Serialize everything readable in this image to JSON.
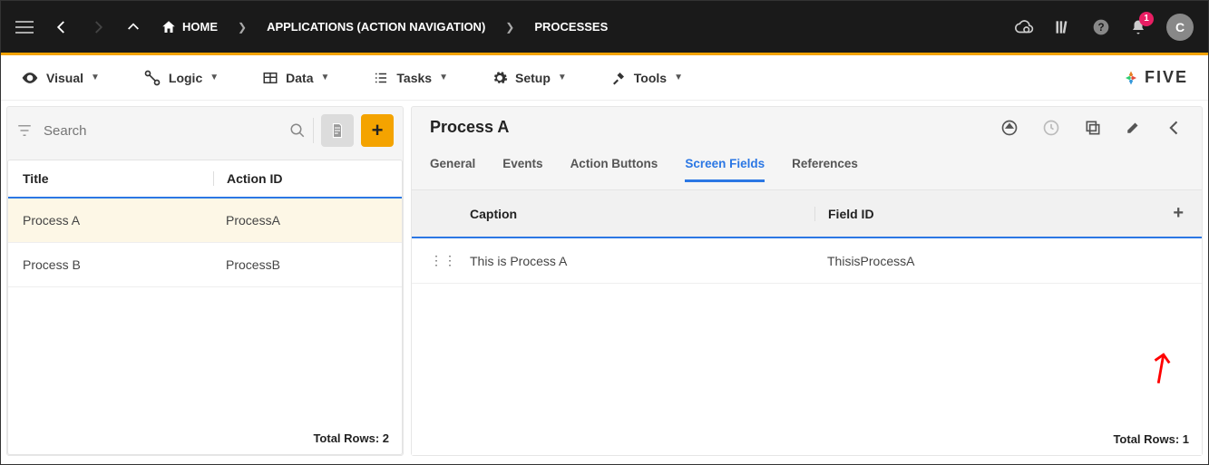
{
  "topbar": {
    "home_label": "HOME",
    "crumb1": "APPLICATIONS (ACTION NAVIGATION)",
    "crumb2": "PROCESSES",
    "notification_count": "1",
    "avatar_letter": "C"
  },
  "menubar": {
    "visual": "Visual",
    "logic": "Logic",
    "data": "Data",
    "tasks": "Tasks",
    "setup": "Setup",
    "tools": "Tools",
    "logo_text": "FIVE"
  },
  "left": {
    "search_placeholder": "Search",
    "col_title": "Title",
    "col_action": "Action ID",
    "rows": [
      {
        "title": "Process A",
        "action_id": "ProcessA",
        "selected": true
      },
      {
        "title": "Process B",
        "action_id": "ProcessB",
        "selected": false
      }
    ],
    "footer": "Total Rows: 2"
  },
  "right": {
    "title": "Process A",
    "tabs": {
      "general": "General",
      "events": "Events",
      "action_buttons": "Action Buttons",
      "screen_fields": "Screen Fields",
      "references": "References"
    },
    "active_tab": "screen_fields",
    "col_caption": "Caption",
    "col_fieldid": "Field ID",
    "rows": [
      {
        "caption": "This is Process A",
        "field_id": "ThisisProcessA"
      }
    ],
    "footer": "Total Rows: 1"
  }
}
